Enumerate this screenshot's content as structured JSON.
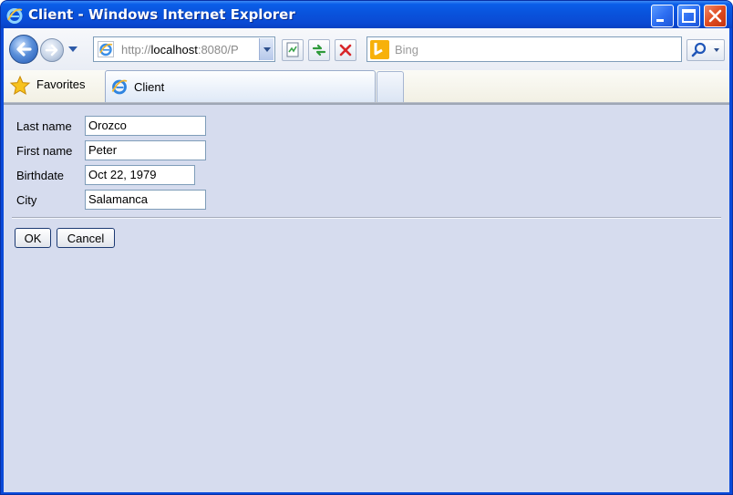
{
  "window": {
    "title": "Client - Windows Internet Explorer"
  },
  "navbar": {
    "address_prefix": "http://",
    "address_host": "localhost",
    "address_rest": ":8080/P",
    "search_placeholder": "Bing"
  },
  "favorites_bar": {
    "favorites_label": "Favorites",
    "active_tab_label": "Client"
  },
  "form": {
    "fields": [
      {
        "label": "Last name",
        "value": "Orozco"
      },
      {
        "label": "First name",
        "value": "Peter"
      },
      {
        "label": "Birthdate",
        "value": "Oct 22, 1979"
      },
      {
        "label": "City",
        "value": "Salamanca"
      }
    ],
    "ok_label": "OK",
    "cancel_label": "Cancel"
  },
  "colors": {
    "titlebar_blue": "#0a4ad4",
    "content_background": "#d6dcee",
    "close_red": "#e04b1f"
  }
}
